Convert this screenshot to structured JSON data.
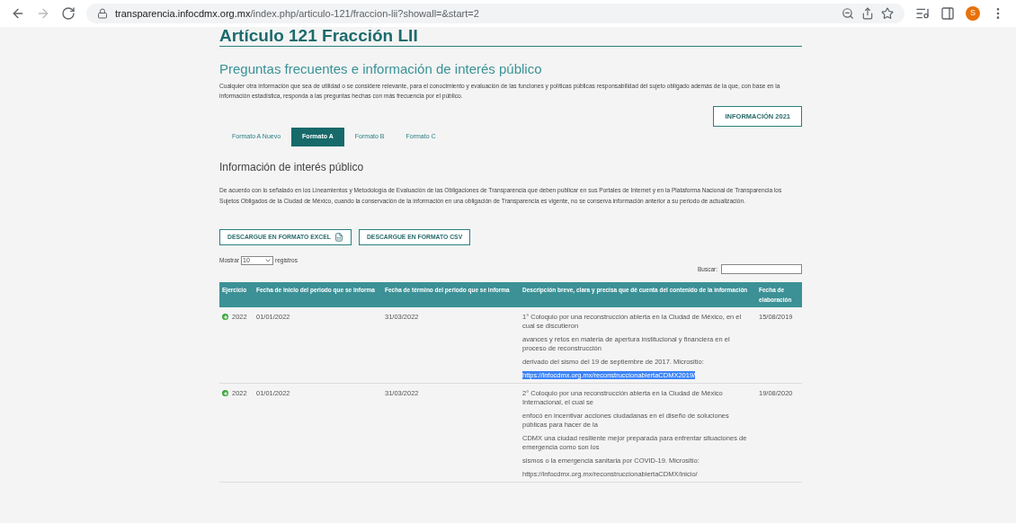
{
  "browser": {
    "url_host": "transparencia.infocdmx.org.mx",
    "url_path": "/index.php/articulo-121/fraccion-lii?showall=&start=2",
    "profile_initial": "S"
  },
  "page": {
    "title": "Artículo 121 Fracción LII",
    "subtitle": "Preguntas frecuentes e información de interés público",
    "intro": "Cualquier otra información que sea de utilidad o se considere relevante, para el conocimiento y evaluación de las funciones y políticas públicas responsabilidad del sujeto obligado además de la que, con base en la información estadística, responda a las preguntas hechas con más frecuencia por el público.",
    "info_button": "INFORMACIÓN 2021",
    "tabs": [
      {
        "label": "Formato A Nuevo",
        "selected": false
      },
      {
        "label": "Formato A",
        "selected": true
      },
      {
        "label": "Formato B",
        "selected": false
      },
      {
        "label": "Formato C",
        "selected": false
      }
    ],
    "section_title": "Información de interés público",
    "section_text": "De acuerdo con lo señalado en los Lineamientos y Metodología de Evaluación de las Obligaciones de Transparencia que deben publicar en sus Portales de Internet y en la Plataforma Nacional de Transparencia los Sujetos Obligados de la Ciudad de México, cuando la conservación de la información en una obligación de Transparencia es vigente, no se conserva información anterior a su periodo de actualización.",
    "download_buttons": [
      {
        "label": "DESCARGUE EN FORMATO EXCEL",
        "kind": "excel"
      },
      {
        "label": "DESCARGUE EN FORMATO CSV",
        "kind": "csv"
      }
    ],
    "show_label": "Mostrar",
    "show_value": "10",
    "show_suffix": "registros",
    "search_label": "Buscar:"
  },
  "table": {
    "columns": [
      "Ejercicio",
      "Fecha de inicio del periodo que se informa",
      "Fecha de término del periodo que se informa",
      "Descripción breve, clara y precisa que dé cuenta del contenido de la información",
      "Fecha de elaboración"
    ],
    "rows": [
      {
        "ejercicio": "2022",
        "inicio": "01/01/2022",
        "termino": "31/03/2022",
        "descripcion": [
          "1° Coloquio por una reconstrucción abierta en la Ciudad de México, en el cual se discutieron",
          "avances y retos en materia de apertura institucional y financiera en el proceso de reconstrucción",
          "derivado del sismo del 19 de septiembre de 2017. Micrositio:"
        ],
        "link": "https://infocdmx.org.mx/reconstruccionabiertaCDMX2019/",
        "link_highlighted": true,
        "elaboracion": "15/08/2019"
      },
      {
        "ejercicio": "2022",
        "inicio": "01/01/2022",
        "termino": "31/03/2022",
        "descripcion": [
          "2° Coloquio por una reconstrucción abierta en la Ciudad de México Internacional, el cual se",
          "enfocó en incentivar acciones ciudadanas en el diseño de soluciones públicas para hacer de la",
          "CDMX una ciudad resiliente mejor preparada para enfrentar situaciones de emergencia como son los",
          "sismos o la emergencia sanitaria por COVID-19. Micrositio:"
        ],
        "link": "https://infocdmx.org.mx/reconstruccionabiertaCDMX/inicio/",
        "link_highlighted": false,
        "elaboracion": "19/08/2020"
      }
    ]
  }
}
